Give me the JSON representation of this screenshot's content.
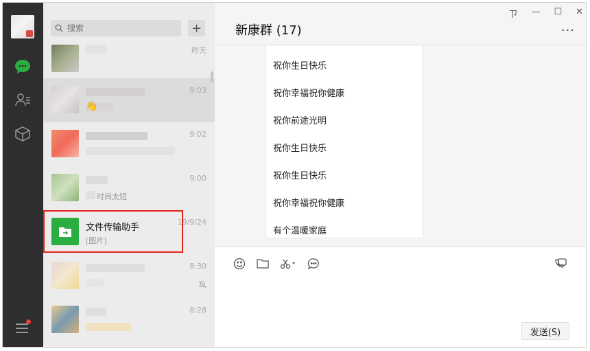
{
  "search": {
    "placeholder": "搜索"
  },
  "list": {
    "add_label": "+",
    "items": [
      {
        "time": "昨天"
      },
      {
        "time": "9:03"
      },
      {
        "time": "9:02"
      },
      {
        "time": "9:00",
        "preview": "时间太短"
      },
      {
        "time": "19/9/24",
        "name": "文件传输助手",
        "preview": "[图片]"
      },
      {
        "time": "8:30"
      },
      {
        "time": "8:28"
      }
    ]
  },
  "chat": {
    "title": "新康群 (17)",
    "more": "···",
    "messages": [
      "祝你生日快乐",
      "祝你幸福祝你健康",
      "祝你前途光明",
      "祝你生日快乐",
      "祝你生日快乐",
      "祝你幸福祝你健康",
      "有个温暖家庭"
    ],
    "send_label": "发送(S)"
  },
  "window": {
    "pin": "ㄗ",
    "minimize": "—",
    "maximize": "☐",
    "close": "✕"
  },
  "colors": {
    "rail": "#2e2e2e",
    "accent": "#2aad41",
    "highlight_box": "#e2231a"
  }
}
